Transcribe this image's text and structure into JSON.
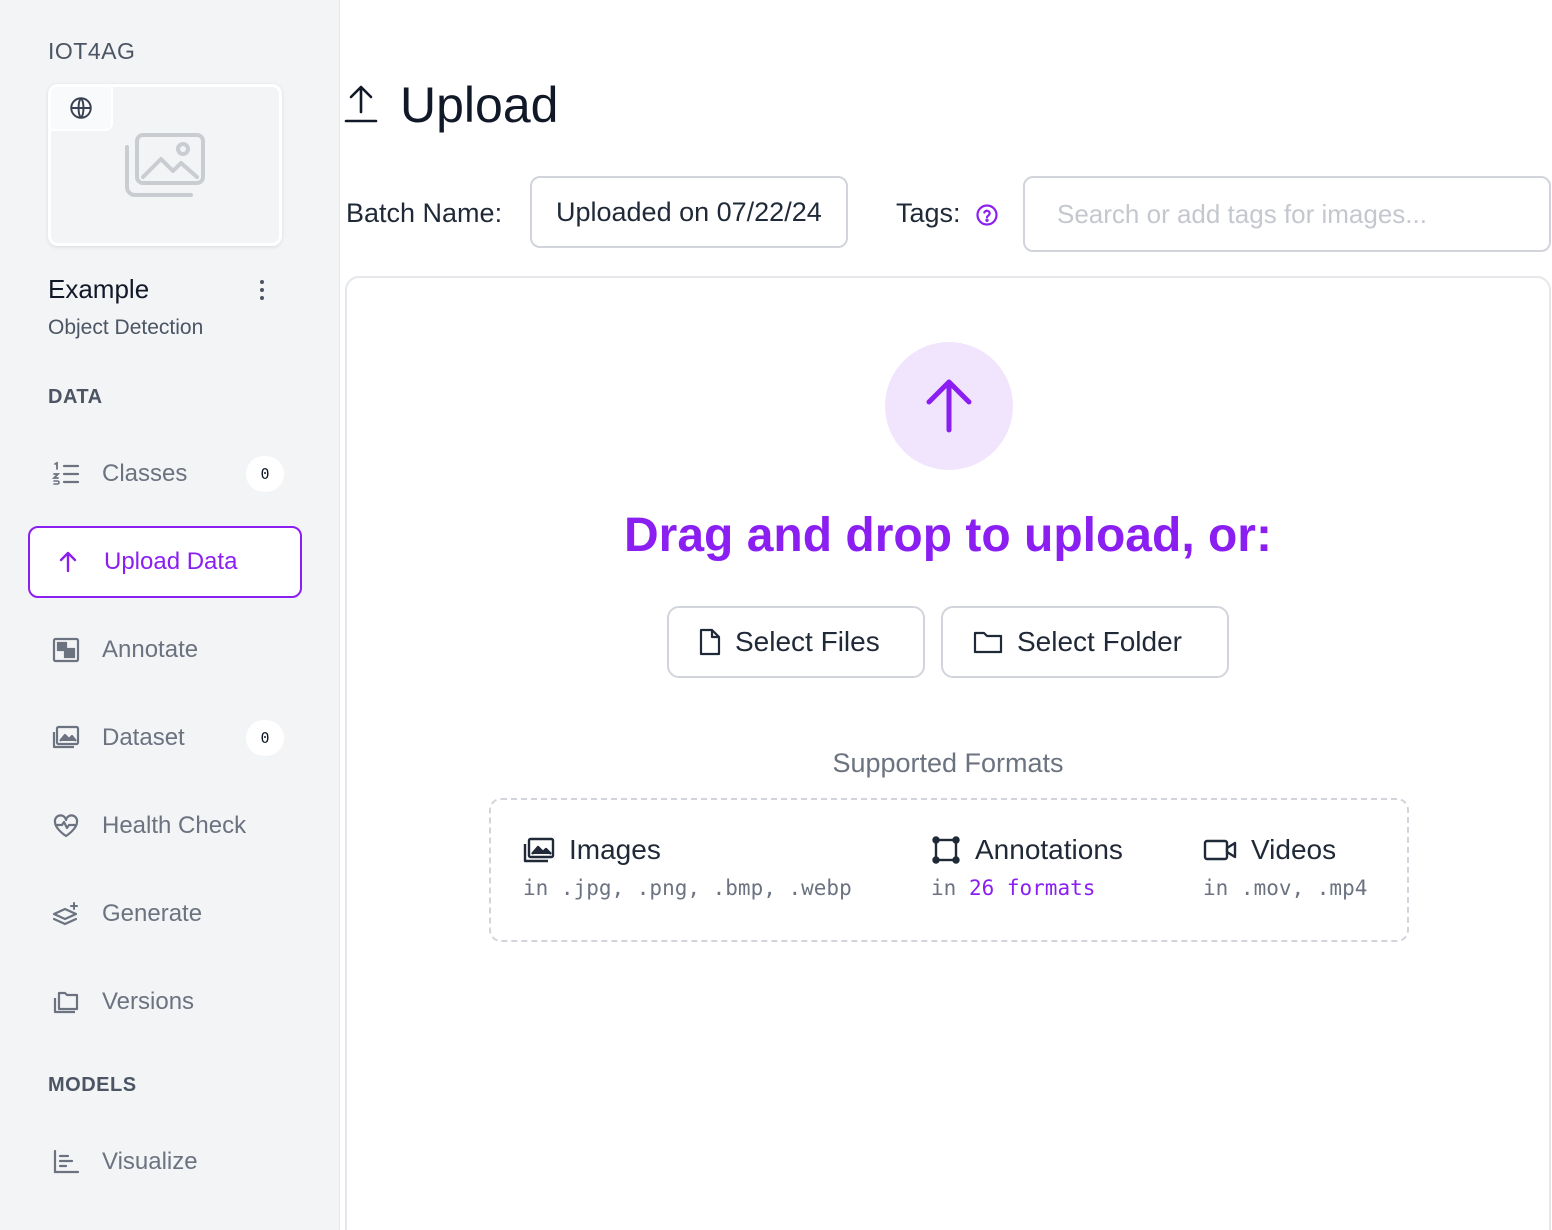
{
  "workspace": {
    "name": "IOT4AG"
  },
  "project": {
    "name": "Example",
    "type": "Object Detection"
  },
  "sidebar": {
    "sections": [
      {
        "title": "DATA"
      },
      {
        "title": "MODELS"
      }
    ],
    "items": [
      {
        "label": "Classes",
        "icon": "list-numbered-icon",
        "badge": "0"
      },
      {
        "label": "Upload Data",
        "icon": "arrow-up-icon",
        "active": true
      },
      {
        "label": "Annotate",
        "icon": "annotate-icon"
      },
      {
        "label": "Dataset",
        "icon": "image-gallery-icon",
        "badge": "0"
      },
      {
        "label": "Health Check",
        "icon": "heart-pulse-icon"
      },
      {
        "label": "Generate",
        "icon": "layers-sparkle-icon"
      },
      {
        "label": "Versions",
        "icon": "folders-icon"
      },
      {
        "label": "Visualize",
        "icon": "bar-chart-icon"
      }
    ]
  },
  "page": {
    "title": "Upload"
  },
  "batch": {
    "label": "Batch Name:",
    "value": "Uploaded on 07/22/24"
  },
  "tags": {
    "label": "Tags:",
    "placeholder": "Search or add tags for images..."
  },
  "dropzone": {
    "headline": "Drag and drop to upload, or:",
    "select_files": "Select Files",
    "select_folder": "Select Folder",
    "formats_title": "Supported Formats",
    "formats": {
      "images": {
        "title": "Images",
        "detail": "in .jpg, .png, .bmp, .webp"
      },
      "annotations": {
        "title": "Annotations",
        "prefix": "in",
        "link": "26 formats"
      },
      "videos": {
        "title": "Videos",
        "detail": "in .mov, .mp4"
      }
    }
  },
  "colors": {
    "accent": "#8b1ff2",
    "accent_light": "#f1e4fd",
    "sidebar_bg": "#f3f4f6"
  }
}
